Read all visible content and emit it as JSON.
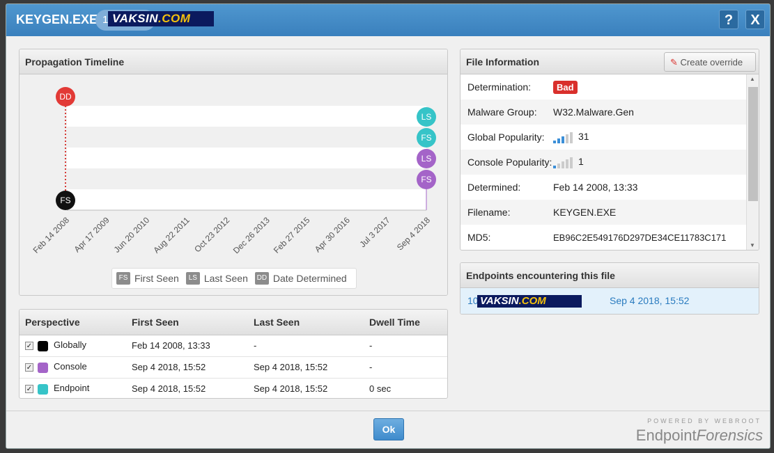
{
  "dialog": {
    "title": "KEYGEN.EXE",
    "title_count": "1",
    "stamp_text_a": "VAKSIN",
    "stamp_text_b": ".COM",
    "help_label": "?",
    "close_label": "X"
  },
  "timeline": {
    "header": "Propagation Timeline",
    "x_ticks": [
      "Feb 14 2008",
      "Apr 17 2009",
      "Jun 20 2010",
      "Aug 22 2011",
      "Oct 23 2012",
      "Dec 26 2013",
      "Feb 27 2015",
      "Apr 30 2016",
      "Jul 3 2017",
      "Sep 4 2018"
    ],
    "markers": [
      {
        "code": "DD",
        "color": "#e23a36"
      },
      {
        "code": "FS",
        "color": "#111111"
      },
      {
        "code": "LS",
        "color": "#36c4c8"
      },
      {
        "code": "FS",
        "color": "#36c4c8"
      },
      {
        "code": "LS",
        "color": "#a464c8"
      },
      {
        "code": "FS",
        "color": "#a464c8"
      }
    ],
    "legend": [
      {
        "code": "FS",
        "label": "First Seen"
      },
      {
        "code": "LS",
        "label": "Last Seen"
      },
      {
        "code": "DD",
        "label": "Date Determined"
      }
    ]
  },
  "perspective": {
    "headers": [
      "Perspective",
      "First Seen",
      "Last Seen",
      "Dwell Time"
    ],
    "rows": [
      {
        "name": "Globally",
        "color": "#000000",
        "first": "Feb 14 2008, 13:33",
        "last": "-",
        "dwell": "-"
      },
      {
        "name": "Console",
        "color": "#a464c8",
        "first": "Sep 4 2018, 15:52",
        "last": "Sep 4 2018, 15:52",
        "dwell": "-"
      },
      {
        "name": "Endpoint",
        "color": "#36c4c8",
        "first": "Sep 4 2018, 15:52",
        "last": "Sep 4 2018, 15:52",
        "dwell": "0 sec"
      }
    ]
  },
  "file_info": {
    "header": "File Information",
    "override_label": "Create override",
    "rows": [
      {
        "label": "Determination:",
        "value": "Bad"
      },
      {
        "label": "Malware Group:",
        "value": "W32.Malware.Gen"
      },
      {
        "label": "Global Popularity:",
        "value": "31"
      },
      {
        "label": "Console Popularity:",
        "value": "1"
      },
      {
        "label": "Determined:",
        "value": "Feb 14 2008, 13:33"
      },
      {
        "label": "Filename:",
        "value": "KEYGEN.EXE"
      },
      {
        "label": "MD5:",
        "value": "EB96C2E549176D297DE34CE11783C171"
      }
    ],
    "global_popularity_level": 3,
    "console_popularity_level": 1
  },
  "endpoints": {
    "header": "Endpoints encountering this file",
    "host_prefix": "10",
    "date": "Sep 4 2018, 15:52"
  },
  "footer": {
    "ok_label": "Ok",
    "powered": "POWERED BY WEBROOT",
    "brand_a": "Endpoint",
    "brand_b": "Forensics"
  }
}
